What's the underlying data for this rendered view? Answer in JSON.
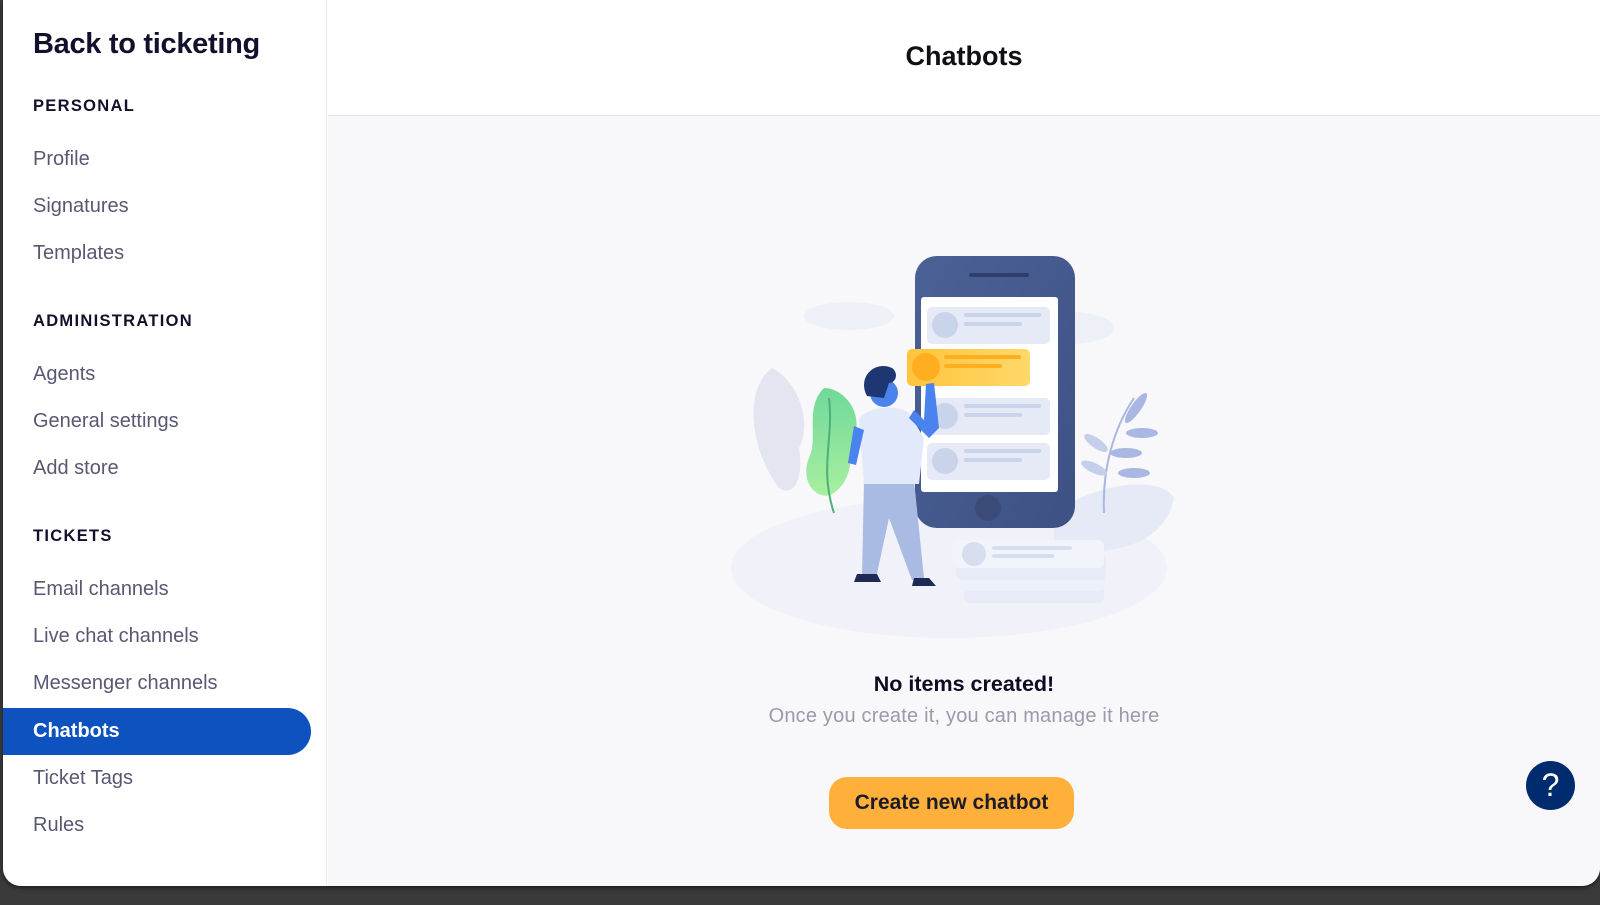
{
  "sidebar": {
    "back_link": "Back to ticketing",
    "sections": [
      {
        "title": "PERSONAL",
        "items": [
          {
            "label": "Profile"
          },
          {
            "label": "Signatures"
          },
          {
            "label": "Templates"
          }
        ]
      },
      {
        "title": "ADMINISTRATION",
        "items": [
          {
            "label": "Agents"
          },
          {
            "label": "General settings"
          },
          {
            "label": "Add store"
          }
        ]
      },
      {
        "title": "TICKETS",
        "items": [
          {
            "label": "Email channels"
          },
          {
            "label": "Live chat channels"
          },
          {
            "label": "Messenger channels"
          },
          {
            "label": "Chatbots",
            "active": true
          },
          {
            "label": "Ticket Tags"
          },
          {
            "label": "Rules"
          }
        ]
      }
    ]
  },
  "header": {
    "title": "Chatbots"
  },
  "empty_state": {
    "illustration": "person-tapping-phone-illustration",
    "title": "No items created!",
    "subtitle": "Once you create it, you can manage it here",
    "button_label": "Create new chatbot"
  },
  "help": {
    "label": "?",
    "icon": "question-mark-icon"
  },
  "colors": {
    "accent": "#0d52bf",
    "cta": "#ffb03b",
    "help_button": "#002b6e",
    "background": "#f8f7fa"
  }
}
